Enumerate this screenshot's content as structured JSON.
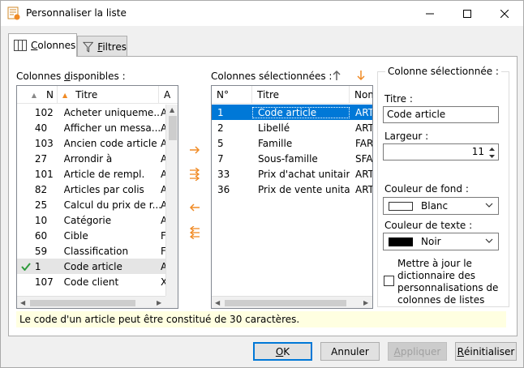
{
  "window": {
    "title": "Personnaliser la liste",
    "icon": "list-settings-icon"
  },
  "tabs": [
    {
      "label_pre": "",
      "label_ul": "C",
      "label_post": "olonnes",
      "icon": "columns-icon",
      "active": true
    },
    {
      "label_pre": "",
      "label_ul": "F",
      "label_post": "iltres",
      "icon": "filter-icon",
      "active": false
    }
  ],
  "available": {
    "label_pre": "Colonnes ",
    "label_ul": "d",
    "label_post": "isponibles :",
    "headers": [
      "N",
      "Titre",
      "A"
    ],
    "rows": [
      {
        "n": "102",
        "titre": "Acheter uniqueme...",
        "x": "A",
        "checked": false
      },
      {
        "n": "40",
        "titre": "Afficher un messa...",
        "x": "A",
        "checked": false
      },
      {
        "n": "103",
        "titre": "Ancien code article",
        "x": "A",
        "checked": false
      },
      {
        "n": "27",
        "titre": "Arrondir à",
        "x": "A",
        "checked": false
      },
      {
        "n": "101",
        "titre": "Article de rempl.",
        "x": "A",
        "checked": false
      },
      {
        "n": "82",
        "titre": "Articles par colis",
        "x": "A",
        "checked": false
      },
      {
        "n": "25",
        "titre": "Calcul du prix de r...",
        "x": "A",
        "checked": false
      },
      {
        "n": "10",
        "titre": "Catégorie",
        "x": "A",
        "checked": false
      },
      {
        "n": "60",
        "titre": "Cible",
        "x": "F",
        "checked": false
      },
      {
        "n": "59",
        "titre": "Classification",
        "x": "F",
        "checked": false
      },
      {
        "n": "1",
        "titre": "Code article",
        "x": "A",
        "checked": true
      },
      {
        "n": "107",
        "titre": "Code client",
        "x": "X",
        "checked": false
      }
    ]
  },
  "selected": {
    "label": "Colonnes sélectionnées :",
    "headers": [
      "N°",
      "Titre",
      "Nom"
    ],
    "rows": [
      {
        "n": "1",
        "titre": "Code article",
        "nom": "ART_"
      },
      {
        "n": "2",
        "titre": "Libellé",
        "nom": "ART_"
      },
      {
        "n": "5",
        "titre": "Famille",
        "nom": "FAR_"
      },
      {
        "n": "7",
        "titre": "Sous-famille",
        "nom": "SFA_"
      },
      {
        "n": "33",
        "titre": "Prix d'achat unitaire",
        "nom": "ART_"
      },
      {
        "n": "36",
        "titre": "Prix de vente unita",
        "nom": "ART_"
      }
    ],
    "selected_index": 0
  },
  "details": {
    "group_title": "Colonne sélectionnée :",
    "titre_label": "Titre :",
    "titre_value": "Code article",
    "largeur_label": "Largeur :",
    "largeur_value": "11",
    "fond_label": "Couleur de fond :",
    "fond_value": "Blanc",
    "texte_label": "Couleur de texte :",
    "texte_value": "Noir",
    "update_label": "Mettre à jour le dictionnaire des personnalisations de colonnes de listes"
  },
  "colors": {
    "accent": "#0078d7",
    "arrow_orange": "#f08a24",
    "fond_swatch": "#ffffff",
    "texte_swatch": "#000000",
    "check_green": "#2e9b3c"
  },
  "info": "Le code d'un article peut être constitué de 30 caractères.",
  "buttons": {
    "ok_ul": "O",
    "ok_post": "K",
    "annuler": "Annuler",
    "appliquer_ul": "A",
    "appliquer_post": "ppliquer",
    "reinit_ul": "R",
    "reinit_post": "éinitialiser"
  }
}
